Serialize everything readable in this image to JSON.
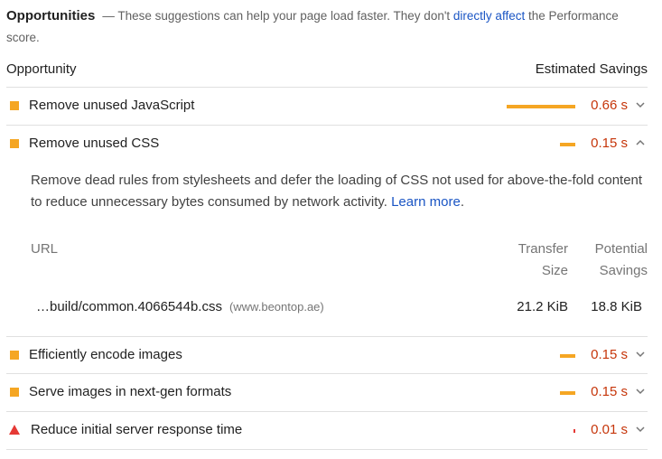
{
  "header": {
    "title": "Opportunities",
    "desc_before": "— These suggestions can help your page load faster. They don't ",
    "desc_link": "directly affect",
    "desc_after": " the Performance score."
  },
  "columns": {
    "opportunity": "Opportunity",
    "savings": "Estimated Savings"
  },
  "audits": [
    {
      "label": "Remove unused JavaScript",
      "savings": "0.66 s",
      "level": "average",
      "bar_fraction": 1.0,
      "expanded": false
    },
    {
      "label": "Remove unused CSS",
      "savings": "0.15 s",
      "level": "average",
      "bar_fraction": 0.23,
      "expanded": true
    },
    {
      "label": "Efficiently encode images",
      "savings": "0.15 s",
      "level": "average",
      "bar_fraction": 0.23,
      "expanded": false
    },
    {
      "label": "Serve images in next-gen formats",
      "savings": "0.15 s",
      "level": "average",
      "bar_fraction": 0.23,
      "expanded": false
    },
    {
      "label": "Reduce initial server response time",
      "savings": "0.01 s",
      "level": "fail",
      "bar_fraction": 0.02,
      "expanded": false
    }
  ],
  "details": {
    "text": "Remove dead rules from stylesheets and defer the loading of CSS not used for above-the-fold content to reduce unnecessary bytes consumed by network activity.",
    "learn_more": "Learn more",
    "table": {
      "headers": {
        "url": "URL",
        "transfer_1": "Transfer",
        "transfer_2": "Size",
        "potential_1": "Potential",
        "potential_2": "Savings"
      },
      "rows": [
        {
          "url": "…build/common.4066544b.css",
          "host": "(www.beontop.ae)",
          "transfer": "21.2 KiB",
          "savings": "18.8 KiB"
        }
      ]
    }
  },
  "colors": {
    "average": "#f5a623",
    "fail": "#e53935",
    "savings_text": "#c6360b",
    "link": "#1a55c4"
  }
}
